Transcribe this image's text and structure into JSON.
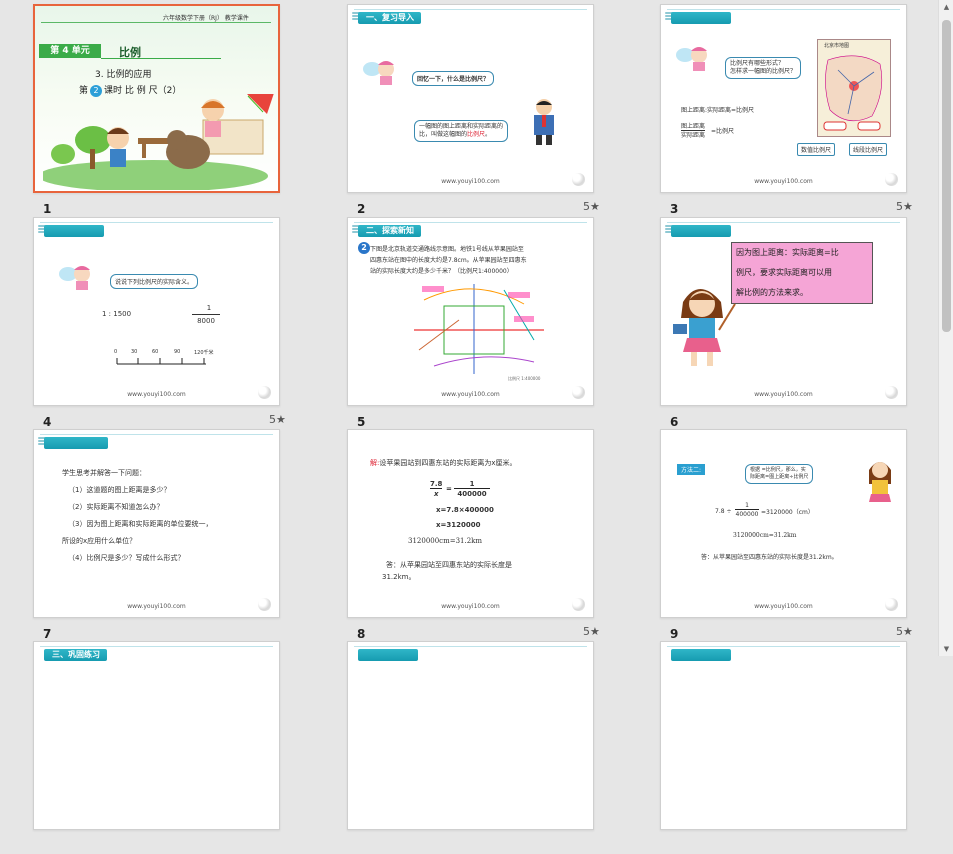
{
  "slides": [
    {
      "number": "1",
      "header_right": "六年级数学下册（RJ）   教学课件",
      "unit_label": "第 4 单元",
      "unit_title": "比例",
      "section": "3. 比例的应用",
      "lesson_prefix": "第",
      "lesson_num": "2",
      "lesson_suffix": "课时  比 例 尺（2）"
    },
    {
      "number": "2",
      "banner": "一、复习导入",
      "bubble1": "回忆一下，什么是比例尺？",
      "bubble2_line1": "一幅图的图上距离和实际距离的",
      "bubble2_line2_pre": "比，叫做这幅图的",
      "bubble2_line2_red": "比例尺",
      "bubble2_line2_post": "。",
      "footer": "www.youyi100.com"
    },
    {
      "number": "3",
      "bubble": "比例尺有哪些形式？\n怎样求一幅图的比例尺？",
      "map_title": "北京市地图",
      "line1": "图上距离:实际距离=比例尺",
      "frac_top": "图上距离",
      "frac_bottom": "实际距离",
      "frac_right": "=比例尺",
      "btn1": "数值比例尺",
      "btn2": "线段比例尺",
      "footer": "www.youyi100.com"
    },
    {
      "number": "4",
      "bubble": "说说下列比例尺的实际含义。",
      "ratio": "1 : 1500",
      "frac_top": "1",
      "frac_bottom": "8000",
      "scale_labels": [
        "0",
        "30",
        "60",
        "90",
        "120千米"
      ],
      "footer": "www.youyi100.com"
    },
    {
      "number": "5",
      "banner": "二、探索新知",
      "problem_num": "2",
      "problem_l1": "下图是北京轨道交通路线示意图。地铁1号线从苹果园站至",
      "problem_l2": "四惠东站在图中的长度大约是7.8cm。从苹果园站至四惠东",
      "problem_l3": "站的实际长度大约是多少千米？（比例尺1:400000）",
      "map_caption": "比例尺 1:400000",
      "footer": "www.youyi100.com"
    },
    {
      "number": "6",
      "callout_l1": "因为图上距离：实际距离=比",
      "callout_l2": "例尺，要求实际距离可以用",
      "callout_l3": "解比例的方法来求。",
      "footer": "www.youyi100.com"
    },
    {
      "number": "7",
      "l1": "学生思考并解答一下问题：",
      "l2": "（1）这道题的图上距离是多少？",
      "l3": "（2）实际距离不知道怎么办？",
      "l4": "（3）因为图上距离和实际距离的单位要统一，",
      "l5": "所设的x应用什么单位？",
      "l6": "（4）比例尺是多少？写成什么形式？",
      "footer": "www.youyi100.com"
    },
    {
      "number": "8",
      "jie": "解:",
      "l1": "设苹果园站到四惠东站的实际距离为x厘米。",
      "f_top": "7.8",
      "f_bottom": "x",
      "f_eq": "=",
      "f2_top": "1",
      "f2_bottom": "400000",
      "l3": "x=7.8×400000",
      "l4": "x=3120000",
      "l5": "3120000cm=31.2km",
      "ans1": "答：从苹果园站至四惠东站的实际长度是",
      "ans2": "31.2km。",
      "footer": "www.youyi100.com"
    },
    {
      "number": "9",
      "method": "方法二:",
      "bubble_l1": "根据",
      "bubble_l2": "=比例尺，那么，实",
      "bubble_l3": "际距离=图上距离÷比例尺",
      "calc_left": "7.8 ÷",
      "calc_top": "1",
      "calc_bottom": "400000",
      "calc_right": "=3120000（cm）",
      "l2": "3120000cm=31.2km",
      "ans": "答：从苹果园站至四惠东站的实际长度是31.2km。",
      "footer": "www.youyi100.com"
    }
  ],
  "row4_banner": "三、巩固练习",
  "star_glyph": "5★",
  "colors": {
    "selected_border": "#e8643c",
    "banner": "#1fa8bc"
  }
}
